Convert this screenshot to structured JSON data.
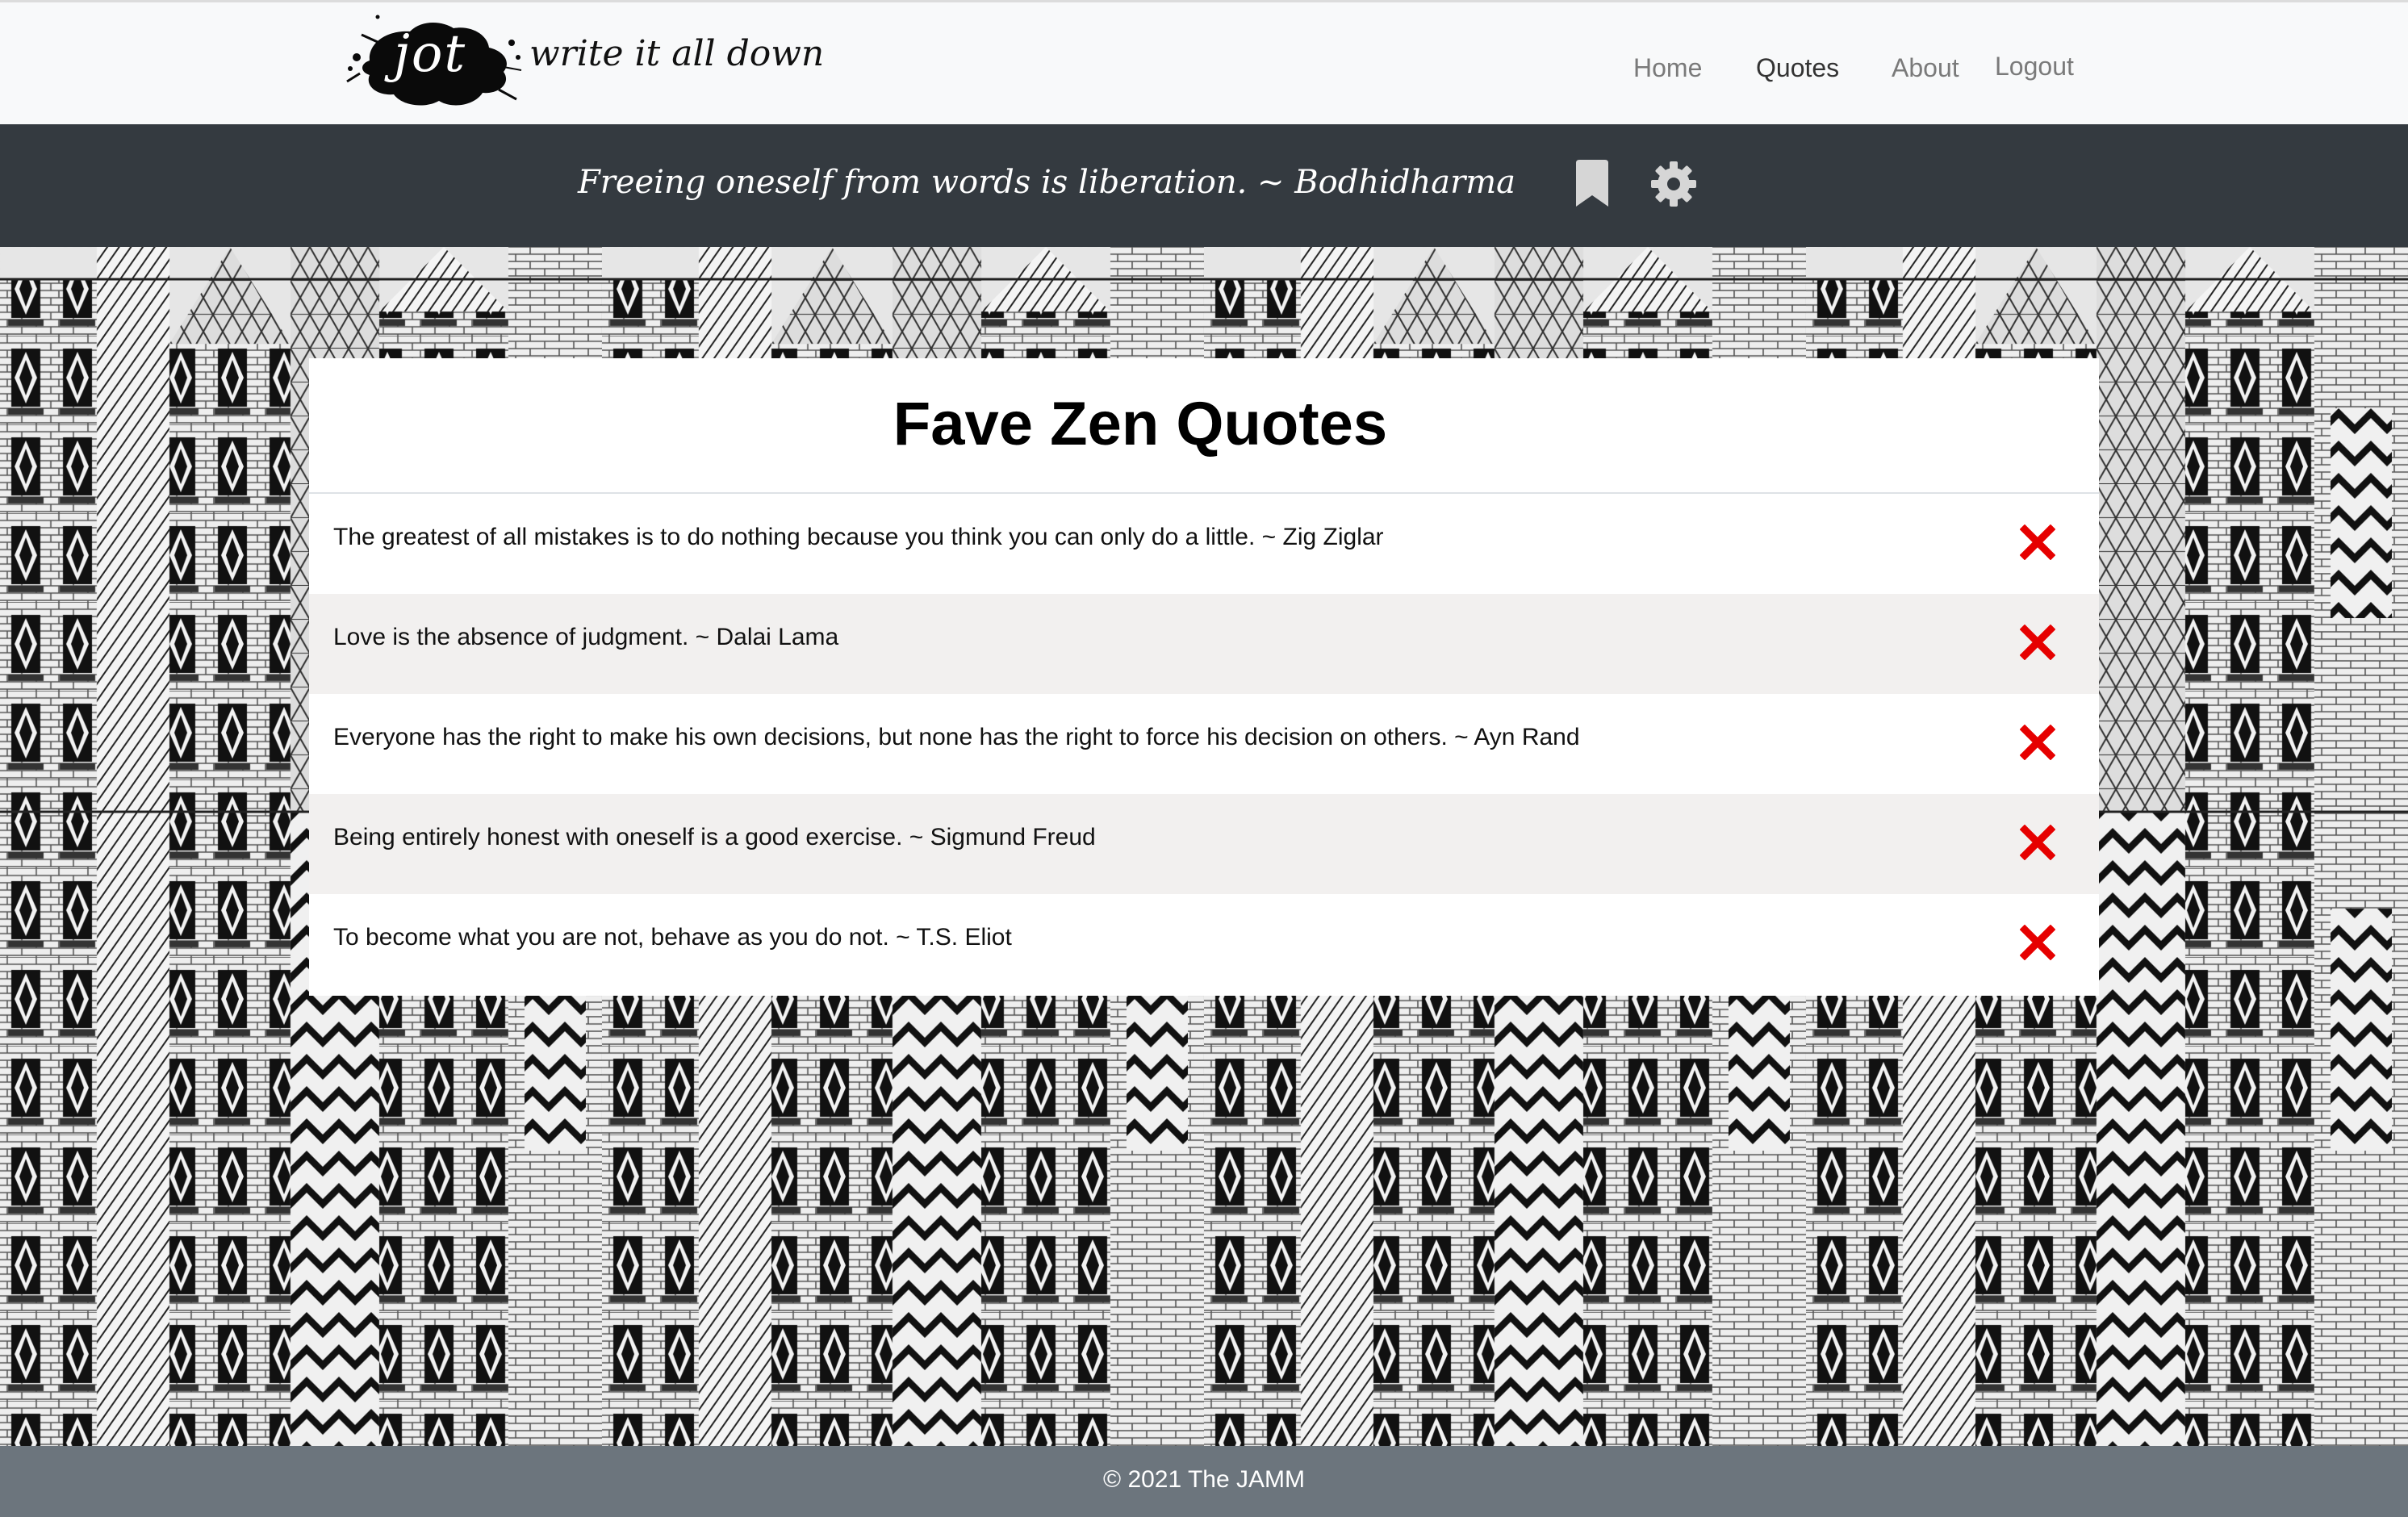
{
  "brand": {
    "logo_text": "jot",
    "tagline": "write it all down"
  },
  "nav": {
    "items": [
      {
        "label": "Home",
        "active": false
      },
      {
        "label": "Quotes",
        "active": true
      },
      {
        "label": "About",
        "active": false
      },
      {
        "label": "Logout",
        "active": false
      }
    ]
  },
  "quote_bar": {
    "daily_quote": "Freeing oneself from words is liberation. ~ Bodhidharma",
    "icons": [
      "bookmark-icon",
      "gear-icon"
    ]
  },
  "card": {
    "title": "Fave Zen Quotes",
    "quotes": [
      {
        "text": "The greatest of all mistakes is to do nothing because you think you can only do a little. ~ Zig Ziglar"
      },
      {
        "text": "Love is the absence of judgment. ~ Dalai Lama"
      },
      {
        "text": "Everyone has the right to make his own decisions, but none has the right to force his decision on others. ~ Ayn Rand"
      },
      {
        "text": "Being entirely honest with oneself is a good exercise. ~ Sigmund Freud"
      },
      {
        "text": "To become what you are not, behave as you do not. ~ T.S. Eliot"
      }
    ],
    "delete_icon": "close-icon"
  },
  "footer": {
    "text": "© 2021 The JAMM"
  },
  "colors": {
    "navbar_bg": "#f8f9fa",
    "quote_bar_bg": "#343a40",
    "footer_bg": "#6c757d",
    "stripe_bg": "#f2f0ef",
    "delete_red": "#e60000",
    "nav_link": "#7a7a7a",
    "nav_link_active": "#333333"
  }
}
